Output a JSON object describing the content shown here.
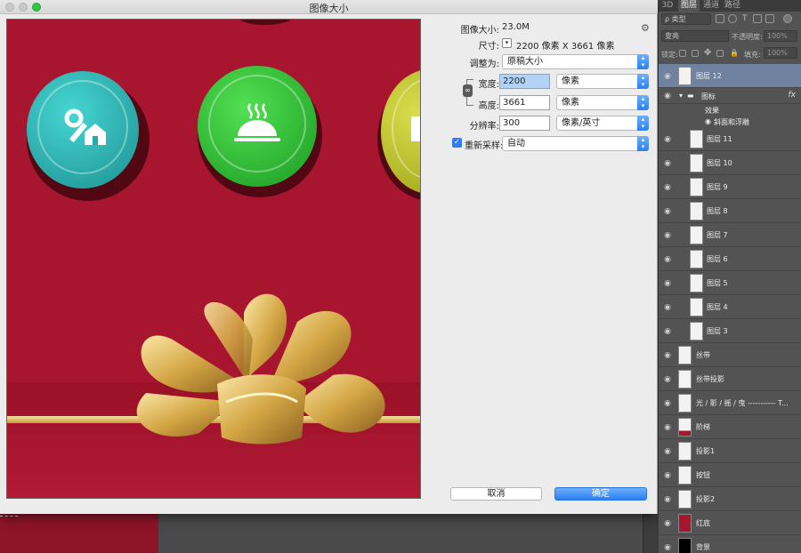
{
  "dialog": {
    "title": "图像大小",
    "image_size_label": "图像大小:",
    "image_size_value": "23.0M",
    "dimensions_label": "尺寸:",
    "dimensions_value": "2200 像素  X  3661 像素",
    "fit_to_label": "调整为:",
    "fit_to_value": "原稿大小",
    "width_label": "宽度:",
    "width_value": "2200",
    "width_unit": "像素",
    "height_label": "高度:",
    "height_value": "3661",
    "height_unit": "像素",
    "resolution_label": "分辨率:",
    "resolution_value": "300",
    "resolution_unit": "像素/英寸",
    "resample_label": "重新采样:",
    "resample_checked": true,
    "resample_value": "自动",
    "cancel_label": "取消",
    "ok_label": "确定",
    "colors": {
      "accent": "#2c7ef3",
      "preview_bg": "#a8152f"
    }
  },
  "panel": {
    "tabs": [
      "3D",
      "图层",
      "通道",
      "路径"
    ],
    "active_tab": "图层",
    "filter_value": "ρ 类型",
    "blend_mode": "变亮",
    "opacity_label": "不透明度:",
    "opacity_value": "100%",
    "lock_label": "锁定:",
    "fill_label": "填充:",
    "fill_value": "100%",
    "layers": [
      {
        "name": "图层 12",
        "selected": true
      },
      {
        "name": "图标",
        "group": true,
        "fx": "fx"
      },
      {
        "name": "效果",
        "sub": 1
      },
      {
        "name": "斜面和浮雕",
        "sub": 2
      },
      {
        "name": "图层 11"
      },
      {
        "name": "图层 10"
      },
      {
        "name": "图层 9"
      },
      {
        "name": "图层 8"
      },
      {
        "name": "图层 7"
      },
      {
        "name": "图层 6"
      },
      {
        "name": "图层 5"
      },
      {
        "name": "图层 4"
      },
      {
        "name": "图层 3"
      },
      {
        "name": "丝带"
      },
      {
        "name": "丝带投影"
      },
      {
        "name": "光 / 影 / 摇 / 曳 ----------- T..."
      },
      {
        "name": "阶梯"
      },
      {
        "name": "投影1"
      },
      {
        "name": "按钮"
      },
      {
        "name": "投影2"
      },
      {
        "name": "红底"
      },
      {
        "name": "背景"
      }
    ]
  }
}
